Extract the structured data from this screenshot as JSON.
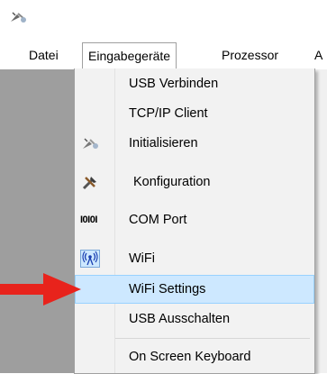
{
  "menubar": {
    "items": [
      "Datei",
      "Eingabegeräte",
      "Prozessor",
      "A"
    ]
  },
  "dropdown": {
    "items": [
      {
        "label": "USB Verbinden",
        "icon": null
      },
      {
        "label": "TCP/IP Client",
        "icon": null
      },
      {
        "label": "Initialisieren",
        "icon": "satellite-dish-icon"
      },
      {
        "label": "Konfiguration",
        "icon": "tools-icon"
      },
      {
        "label": "COM Port",
        "icon": "binary-port-icon"
      },
      {
        "label": "WiFi",
        "icon": "wifi-antenna-icon"
      },
      {
        "label": "WiFi Settings",
        "icon": null,
        "highlighted": true
      },
      {
        "label": "USB Ausschalten",
        "icon": null
      },
      {
        "label": "On Screen Keyboard",
        "icon": null
      }
    ],
    "com_icon_text": "I0I0I",
    "highlight_color": "#cde8ff"
  },
  "annotation": {
    "arrow_color": "#e8231c"
  }
}
